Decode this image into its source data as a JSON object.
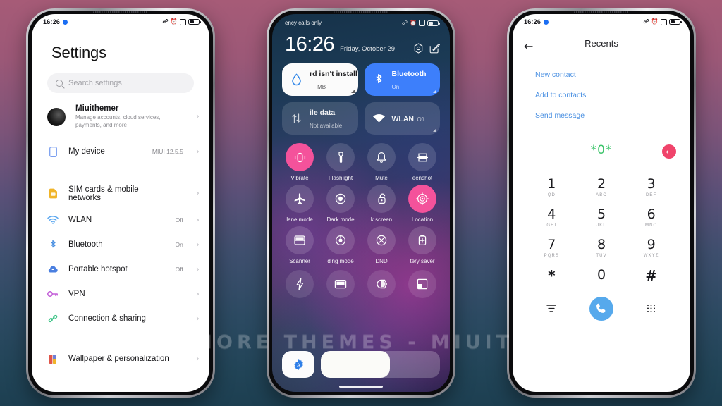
{
  "watermark": "VISIT FOR MORE THEMES - MIUITHEMER.COM",
  "background": {
    "top_color": "#a65b77",
    "bottom_color": "#1d3f51"
  },
  "phone1": {
    "statusbar": {
      "time": "16:26",
      "icons": [
        "bluetooth-icon",
        "alarm-icon",
        "dnd-icon",
        "battery-icon"
      ]
    },
    "title": "Settings",
    "search": {
      "placeholder": "Search settings",
      "icon": "search-icon"
    },
    "account": {
      "name": "Miuithemer",
      "subtitle": "Manage accounts, cloud services, payments, and more"
    },
    "items": [
      {
        "label": "My device",
        "value": "MIUI 12.5.5",
        "icon": "phone-outline-icon",
        "color": "#7b9ff0"
      },
      {
        "label": "SIM cards & mobile networks",
        "value": "",
        "icon": "sim-card-icon",
        "color": "#f0b429"
      },
      {
        "label": "WLAN",
        "value": "Off",
        "icon": "wifi-icon",
        "color": "#5aa7f0"
      },
      {
        "label": "Bluetooth",
        "value": "On",
        "icon": "bluetooth-icon",
        "color": "#4a90e2"
      },
      {
        "label": "Portable hotspot",
        "value": "Off",
        "icon": "hotspot-cloud-icon",
        "color": "#4a7fe0"
      },
      {
        "label": "VPN",
        "value": "",
        "icon": "key-icon",
        "color": "#c35fd8"
      },
      {
        "label": "Connection & sharing",
        "value": "",
        "icon": "link-icon",
        "color": "#3fc488"
      },
      {
        "label": "Wallpaper & personalization",
        "value": "",
        "icon": "wallpaper-icon",
        "color": "#e0564a"
      }
    ],
    "chevron": "›"
  },
  "phone2": {
    "statusbar": {
      "carrier": "ency calls only",
      "icons": [
        "bluetooth-icon",
        "alarm-icon",
        "dnd-icon",
        "battery-icon"
      ]
    },
    "clock": {
      "time": "16:26",
      "date": "Friday, October 29"
    },
    "header_icons": [
      "settings-gear-icon",
      "edit-icon"
    ],
    "big_tiles": [
      {
        "title": "rd isn't install",
        "subtitle": "MB",
        "value": "––",
        "icon": "data-usage-drop-icon",
        "state": "white"
      },
      {
        "title": "Bluetooth",
        "subtitle": "On",
        "icon": "bluetooth-icon",
        "state": "blue"
      },
      {
        "title": "ile data",
        "subtitle": "Not available",
        "icon": "mobile-data-icon",
        "state": "dim"
      },
      {
        "title": "WLAN",
        "subtitle": "Off",
        "icon": "wifi-icon",
        "state": "dim"
      }
    ],
    "toggles": [
      {
        "label": "Vibrate",
        "icon": "vibrate-icon",
        "on": true
      },
      {
        "label": "Flashlight",
        "icon": "flashlight-icon",
        "on": false
      },
      {
        "label": "Mute",
        "icon": "bell-icon",
        "on": false
      },
      {
        "label": "eenshot",
        "icon": "screenshot-icon",
        "on": false
      },
      {
        "label": "lane mode",
        "icon": "airplane-icon",
        "on": false
      },
      {
        "label": "Dark mode",
        "icon": "dark-mode-icon",
        "on": false
      },
      {
        "label": "k screen",
        "icon": "lock-icon",
        "on": false
      },
      {
        "label": "Location",
        "icon": "location-icon",
        "on": true
      },
      {
        "label": "Scanner",
        "icon": "scanner-icon",
        "on": false
      },
      {
        "label": "ding mode",
        "icon": "reading-mode-icon",
        "on": false
      },
      {
        "label": "DND",
        "icon": "dnd-icon",
        "on": false
      },
      {
        "label": "tery saver",
        "icon": "battery-saver-icon",
        "on": false
      }
    ],
    "toggles_extra": [
      {
        "label": "",
        "icon": "lightning-icon",
        "on": false
      },
      {
        "label": "",
        "icon": "cast-icon",
        "on": false
      },
      {
        "label": "",
        "icon": "sync-icon",
        "on": false
      },
      {
        "label": "",
        "icon": "split-screen-icon",
        "on": false
      }
    ],
    "brightness": {
      "auto_icon": "auto-brightness-icon",
      "level_percent": 58
    }
  },
  "phone3": {
    "statusbar": {
      "time": "16:26",
      "icons": [
        "bluetooth-icon",
        "alarm-icon",
        "dnd-icon",
        "battery-icon"
      ]
    },
    "header": {
      "back_icon": "back-arrow-icon",
      "title": "Recents"
    },
    "links": [
      "New contact",
      "Add to contacts",
      "Send message"
    ],
    "number_display": {
      "value": "*0*",
      "color": "#3cc46a"
    },
    "delete_button": {
      "icon": "backspace-icon",
      "color": "#f0446b",
      "glyph": "←"
    },
    "keypad": [
      {
        "digit": "1",
        "letters": "QD"
      },
      {
        "digit": "2",
        "letters": "ABC"
      },
      {
        "digit": "3",
        "letters": "DEF"
      },
      {
        "digit": "4",
        "letters": "GHI"
      },
      {
        "digit": "5",
        "letters": "JKL"
      },
      {
        "digit": "6",
        "letters": "MNO"
      },
      {
        "digit": "7",
        "letters": "PQRS"
      },
      {
        "digit": "8",
        "letters": "TUV"
      },
      {
        "digit": "9",
        "letters": "WXYZ"
      },
      {
        "digit": "*",
        "letters": ""
      },
      {
        "digit": "0",
        "letters": "+"
      },
      {
        "digit": "#",
        "letters": ""
      }
    ],
    "actions": {
      "left_icon": "menu-icon",
      "call_icon": "call-icon",
      "right_icon": "keypad-icon",
      "call_color": "#56a9ec"
    }
  }
}
